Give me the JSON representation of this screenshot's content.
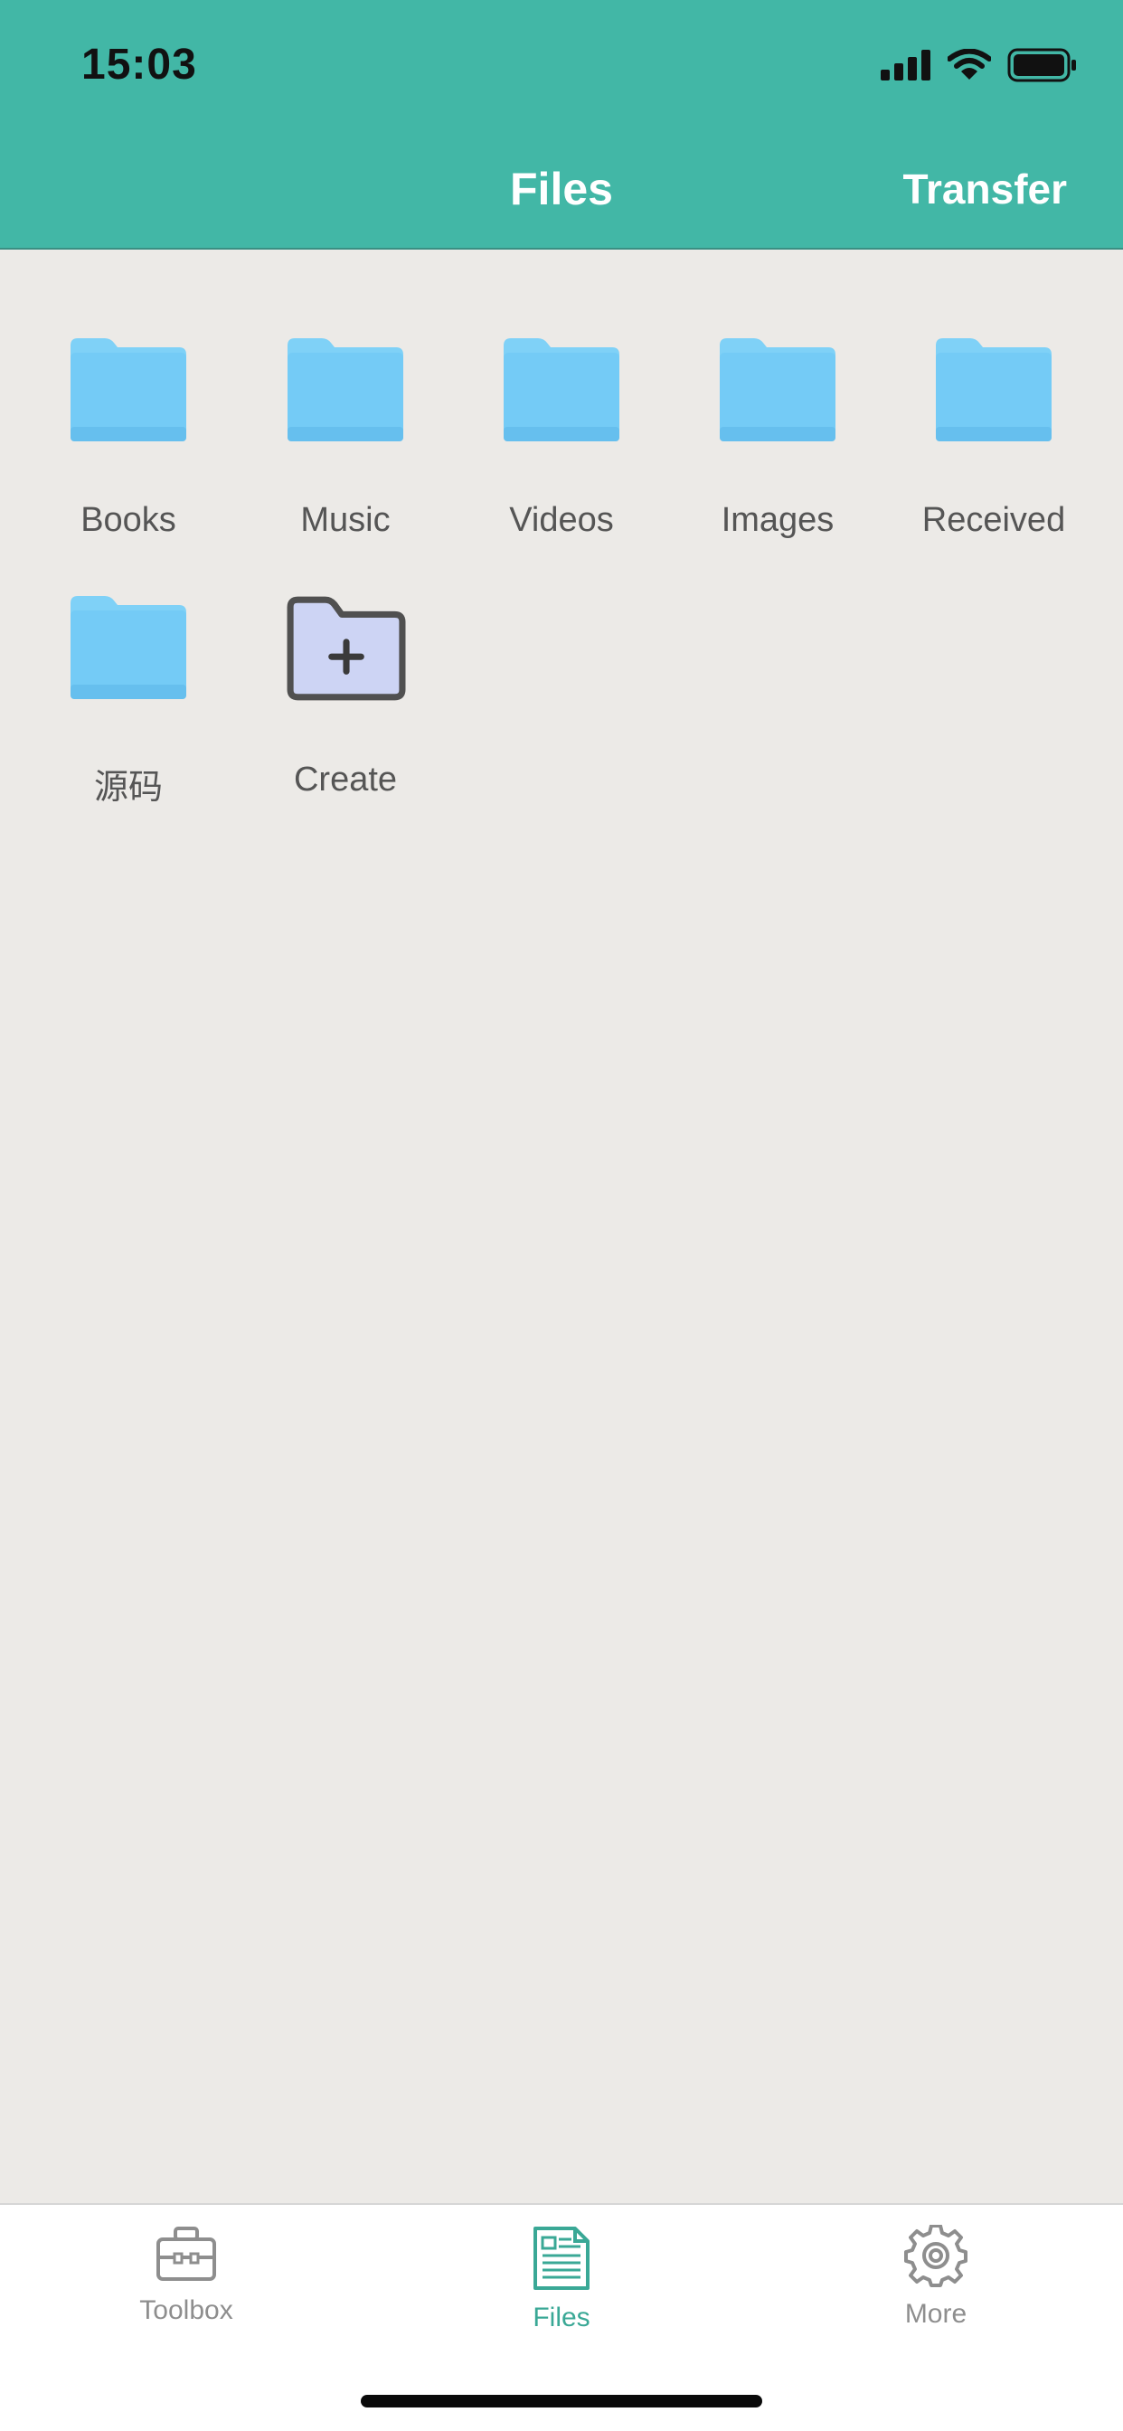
{
  "status_bar": {
    "time": "15:03",
    "icons": [
      "signal-icon",
      "wifi-icon",
      "battery-icon"
    ]
  },
  "nav": {
    "title": "Files",
    "transfer_label": "Transfer"
  },
  "folders": [
    {
      "label": "Books",
      "icon": "folder-icon"
    },
    {
      "label": "Music",
      "icon": "folder-icon"
    },
    {
      "label": "Videos",
      "icon": "folder-icon"
    },
    {
      "label": "Images",
      "icon": "folder-icon"
    },
    {
      "label": "Received",
      "icon": "folder-icon"
    },
    {
      "label": "源码",
      "icon": "folder-icon"
    }
  ],
  "create": {
    "label": "Create",
    "icon": "folder-add-icon"
  },
  "tabs": [
    {
      "label": "Toolbox",
      "icon": "toolbox-icon",
      "active": false
    },
    {
      "label": "Files",
      "icon": "document-icon",
      "active": true
    },
    {
      "label": "More",
      "icon": "gear-icon",
      "active": false
    }
  ],
  "colors": {
    "header": "#42b7a6",
    "background": "#eceae7",
    "folder": "#74cbf6",
    "active_tab": "#3aa896",
    "inactive_tab": "#8e8e8e"
  }
}
